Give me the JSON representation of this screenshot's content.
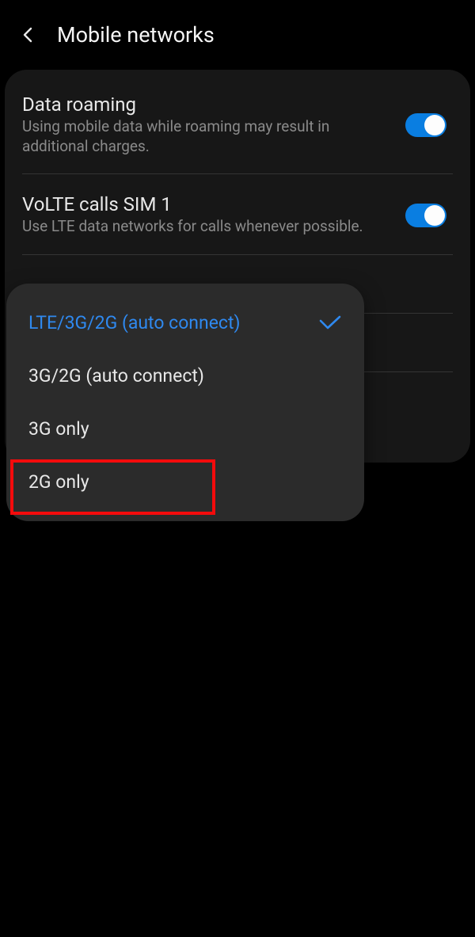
{
  "header": {
    "title": "Mobile networks"
  },
  "settings": {
    "roaming": {
      "title": "Data roaming",
      "desc": "Using mobile data while roaming may result in additional charges."
    },
    "volte": {
      "title": "VoLTE calls SIM 1",
      "desc": "Use LTE data networks for calls whenever possible."
    }
  },
  "dropdown": {
    "options": [
      {
        "label": "LTE/3G/2G (auto connect)"
      },
      {
        "label": "3G/2G (auto connect)"
      },
      {
        "label": "3G only"
      },
      {
        "label": "2G only"
      }
    ]
  }
}
